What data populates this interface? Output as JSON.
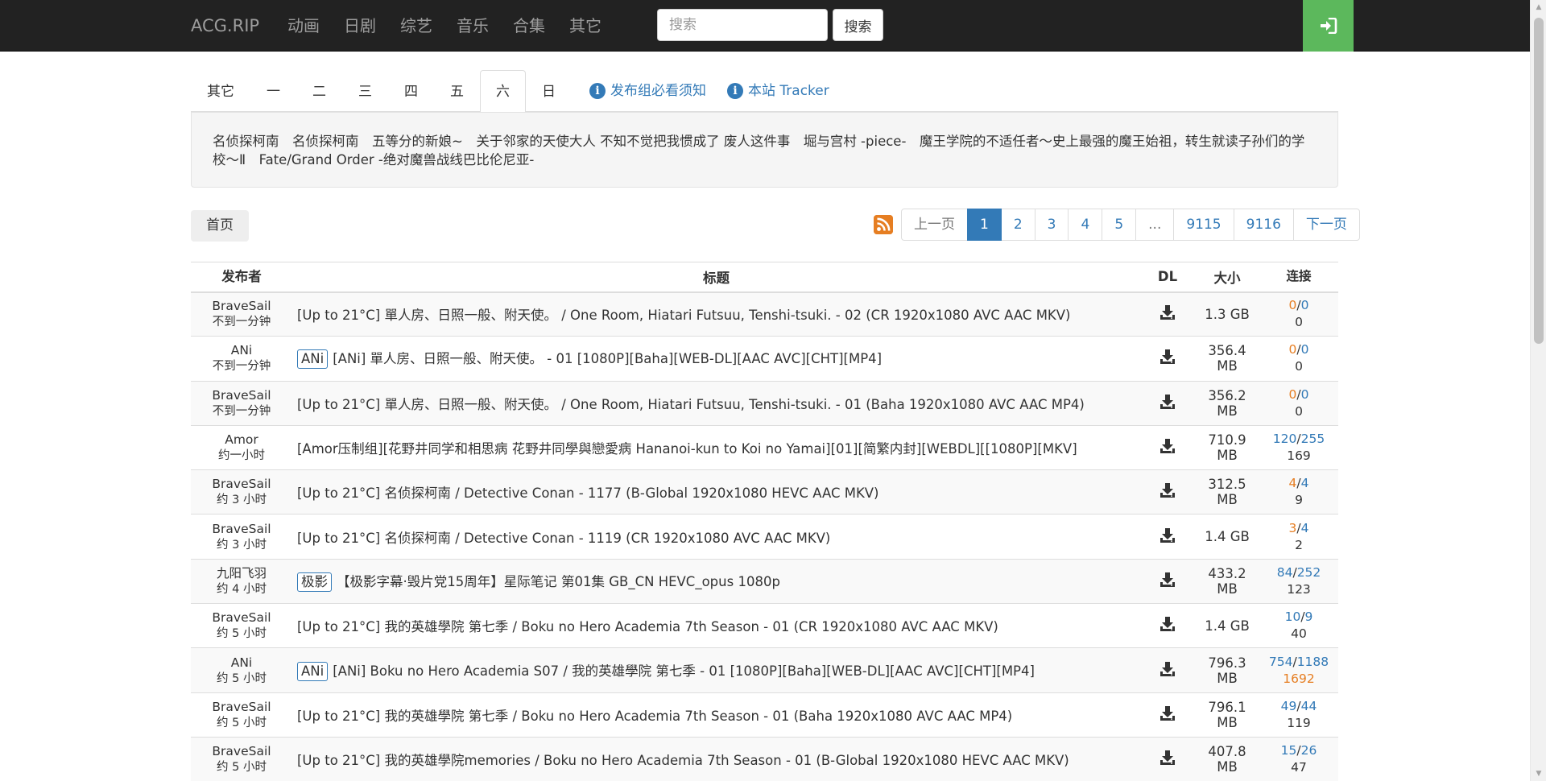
{
  "navbar": {
    "brand": "ACG.RIP",
    "links": [
      "动画",
      "日剧",
      "综艺",
      "音乐",
      "合集",
      "其它"
    ],
    "search_placeholder": "搜索",
    "search_button": "搜索",
    "login_icon": "sign-in-icon"
  },
  "tabs": {
    "days": [
      "其它",
      "一",
      "二",
      "三",
      "四",
      "五",
      "六",
      "日"
    ],
    "active_index": 6,
    "info_links": [
      "发布组必看须知",
      "本站 Tracker"
    ]
  },
  "weekly_titles": "名侦探柯南　名侦探柯南　五等分的新娘~　关于邻家的天使大人 不知不觉把我惯成了 废人这件事　堀与宫村 -piece-　魔王学院的不适任者～史上最强的魔王始祖，转生就读子孙们的学校～Ⅱ　Fate/Grand Order -绝对魔兽战线巴比伦尼亚-",
  "pager": {
    "home": "首页",
    "rss_icon": "rss-icon",
    "pages": [
      "上一页",
      "1",
      "2",
      "3",
      "4",
      "5",
      "...",
      "9115",
      "9116",
      "下一页"
    ],
    "active_page": "1"
  },
  "table": {
    "headers": [
      "发布者",
      "标题",
      "DL",
      "大小",
      "连接"
    ],
    "rows": [
      {
        "publisher": "BraveSail",
        "time": "不到一分钟",
        "badge": "",
        "title": "[Up to 21°C] 單人房、日照一般、附天使。 / One Room, Hiatari Futsuu, Tenshi-tsuki. - 02 (CR 1920x1080 AVC AAC MKV)",
        "size": "1.3 GB",
        "seeders": "0",
        "leechers": "0",
        "completed": "0",
        "seed_color": "orange",
        "done_color": "dark"
      },
      {
        "publisher": "ANi",
        "time": "不到一分钟",
        "badge": "ANi",
        "title": "[ANi] 單人房、日照一般、附天使。 - 01 [1080P][Baha][WEB-DL][AAC AVC][CHT][MP4]",
        "size": "356.4 MB",
        "seeders": "0",
        "leechers": "0",
        "completed": "0",
        "seed_color": "orange",
        "done_color": "dark"
      },
      {
        "publisher": "BraveSail",
        "time": "不到一分钟",
        "badge": "",
        "title": "[Up to 21°C] 單人房、日照一般、附天使。 / One Room, Hiatari Futsuu, Tenshi-tsuki. - 01 (Baha 1920x1080 AVC AAC MP4)",
        "size": "356.2 MB",
        "seeders": "0",
        "leechers": "0",
        "completed": "0",
        "seed_color": "orange",
        "done_color": "dark"
      },
      {
        "publisher": "Amor",
        "time": "约一小时",
        "badge": "",
        "title": "[Amor压制组][花野井同学和相思病 花野井同學與戀愛病 Hananoi-kun to Koi no Yamai][01][简繁内封][WEBDL][[1080P][MKV]",
        "size": "710.9 MB",
        "seeders": "120",
        "leechers": "255",
        "completed": "169",
        "seed_color": "blue",
        "done_color": "dark"
      },
      {
        "publisher": "BraveSail",
        "time": "约 3 小时",
        "badge": "",
        "title": "[Up to 21°C] 名侦探柯南 / Detective Conan - 1177 (B-Global 1920x1080 HEVC AAC MKV)",
        "size": "312.5 MB",
        "seeders": "4",
        "leechers": "4",
        "completed": "9",
        "seed_color": "orange",
        "done_color": "dark"
      },
      {
        "publisher": "BraveSail",
        "time": "约 3 小时",
        "badge": "",
        "title": "[Up to 21°C] 名侦探柯南 / Detective Conan - 1119 (CR 1920x1080 AVC AAC MKV)",
        "size": "1.4 GB",
        "seeders": "3",
        "leechers": "4",
        "completed": "2",
        "seed_color": "orange",
        "done_color": "dark"
      },
      {
        "publisher": "九阳飞羽",
        "time": "约 4 小时",
        "badge": "极影",
        "title": "【极影字幕·毁片党15周年】星际笔记 第01集 GB_CN HEVC_opus 1080p",
        "size": "433.2 MB",
        "seeders": "84",
        "leechers": "252",
        "completed": "123",
        "seed_color": "blue",
        "done_color": "dark"
      },
      {
        "publisher": "BraveSail",
        "time": "约 5 小时",
        "badge": "",
        "title": "[Up to 21°C] 我的英雄學院 第七季 / Boku no Hero Academia 7th Season - 01 (CR 1920x1080 AVC AAC MKV)",
        "size": "1.4 GB",
        "seeders": "10",
        "leechers": "9",
        "completed": "40",
        "seed_color": "blue",
        "done_color": "dark"
      },
      {
        "publisher": "ANi",
        "time": "约 5 小时",
        "badge": "ANi",
        "title": "[ANi] Boku no Hero Academia S07 / 我的英雄學院 第七季 - 01 [1080P][Baha][WEB-DL][AAC AVC][CHT][MP4]",
        "size": "796.3 MB",
        "seeders": "754",
        "leechers": "1188",
        "completed": "1692",
        "seed_color": "blue",
        "done_color": "orange"
      },
      {
        "publisher": "BraveSail",
        "time": "约 5 小时",
        "badge": "",
        "title": "[Up to 21°C] 我的英雄學院 第七季 / Boku no Hero Academia 7th Season - 01 (Baha 1920x1080 AVC AAC MP4)",
        "size": "796.1 MB",
        "seeders": "49",
        "leechers": "44",
        "completed": "119",
        "seed_color": "blue",
        "done_color": "dark"
      },
      {
        "publisher": "BraveSail",
        "time": "约 5 小时",
        "badge": "",
        "title": "[Up to 21°C] 我的英雄學院memories / Boku no Hero Academia 7th Season - 01 (B-Global 1920x1080 HEVC AAC MKV)",
        "size": "407.8 MB",
        "seeders": "15",
        "leechers": "26",
        "completed": "47",
        "seed_color": "blue",
        "done_color": "dark"
      }
    ]
  },
  "colors": {
    "navbar_bg": "#222222",
    "login_green": "#5cb85c",
    "link_blue": "#337ab7",
    "seed_orange": "#e67e22"
  }
}
